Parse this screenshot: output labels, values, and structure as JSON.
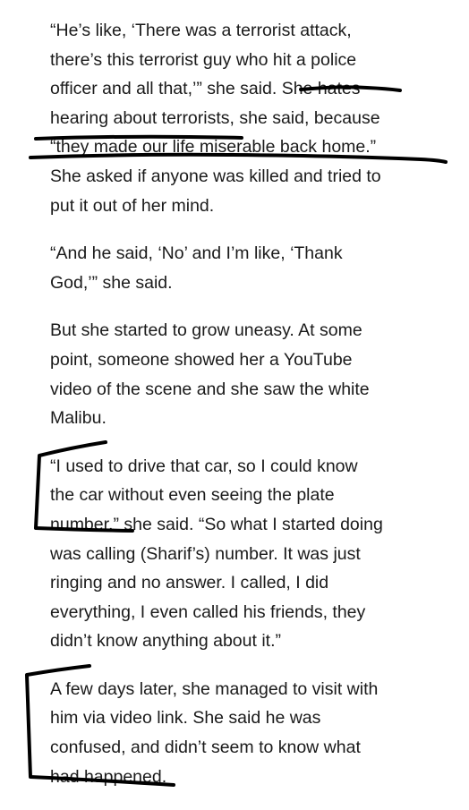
{
  "article": {
    "paragraphs": [
      {
        "lines": [
          "“He’s like, ‘There was a terrorist attack,",
          "there’s this terrorist guy who hit a police",
          "officer and all that,’” she said. She hates",
          "hearing about terrorists, she said, because",
          "“they made our life miserable back home.”",
          "She asked if anyone was killed and tried to",
          "put it out of her mind."
        ]
      },
      {
        "lines": [
          "“And he said, ‘No’ and I’m like, ‘Thank",
          "God,’” she said."
        ]
      },
      {
        "lines": [
          "But she started to grow uneasy. At some",
          "point, someone showed her a YouTube",
          "video of the scene and she saw the white",
          "Malibu."
        ]
      },
      {
        "lines": [
          "“I used to drive that car, so I could know",
          "the car without even seeing the plate",
          "number,” she said. “So what I started doing",
          "was calling (Sharif’s) number. It was just",
          "ringing and no answer. I called, I did",
          "everything, I even called his friends, they",
          "didn’t know anything about it.”"
        ]
      },
      {
        "lines": [
          "A few days later, she managed to visit with",
          "him via video link. She said he was",
          "confused, and didn’t seem to know what",
          "had happened."
        ]
      }
    ]
  },
  "colors": {
    "text": "#1a1a1a",
    "annotation_ink": "#000000",
    "background": "#ffffff"
  }
}
